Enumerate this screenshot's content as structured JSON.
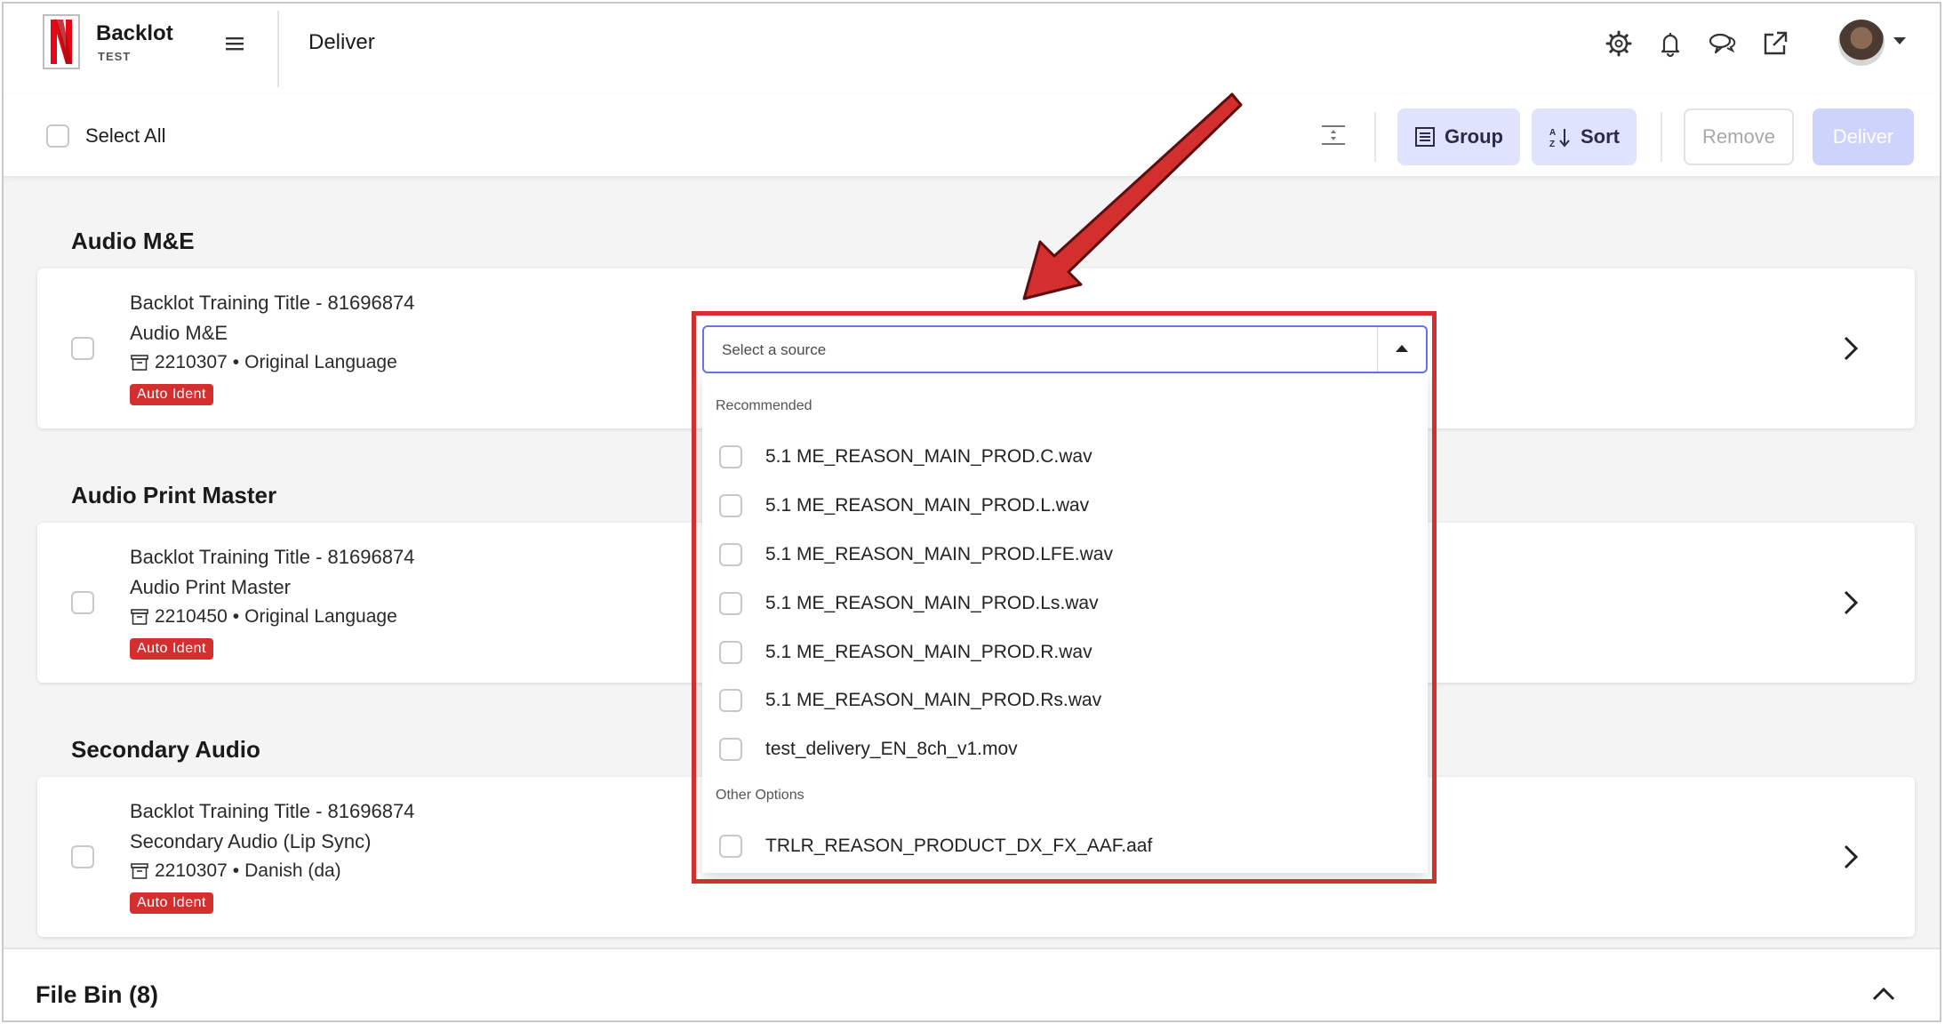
{
  "app": {
    "name": "Backlot",
    "env": "TEST",
    "page_title": "Deliver"
  },
  "header_icons": [
    "gear-icon",
    "bell-icon",
    "chat-icon",
    "external-link-icon"
  ],
  "toolbar": {
    "select_all_label": "Select All",
    "group_label": "Group",
    "sort_label": "Sort",
    "remove_label": "Remove",
    "deliver_label": "Deliver"
  },
  "sections": [
    {
      "title": "Audio M&E",
      "card": {
        "title": "Backlot Training Title - 81696874",
        "subtitle": "Audio M&E",
        "asset_id": "2210307",
        "language": "Original Language",
        "badge": "Auto Ident"
      }
    },
    {
      "title": "Audio Print Master",
      "card": {
        "title": "Backlot Training Title - 81696874",
        "subtitle": "Audio Print Master",
        "asset_id": "2210450",
        "language": "Original Language",
        "badge": "Auto Ident"
      }
    },
    {
      "title": "Secondary Audio",
      "card": {
        "title": "Backlot Training Title - 81696874",
        "subtitle": "Secondary Audio (Lip Sync)",
        "asset_id": "2210307",
        "language": "Danish (da)",
        "badge": "Auto Ident"
      }
    }
  ],
  "meta_separator": "•",
  "dropdown": {
    "placeholder": "Select a source",
    "recommended_label": "Recommended",
    "recommended": [
      "5.1 ME_REASON_MAIN_PROD.C.wav",
      "5.1 ME_REASON_MAIN_PROD.L.wav",
      "5.1 ME_REASON_MAIN_PROD.LFE.wav",
      "5.1 ME_REASON_MAIN_PROD.Ls.wav",
      "5.1 ME_REASON_MAIN_PROD.R.wav",
      "5.1 ME_REASON_MAIN_PROD.Rs.wav",
      "test_delivery_EN_8ch_v1.mov"
    ],
    "other_label": "Other Options",
    "other": [
      "TRLR_REASON_PRODUCT_DX_FX_AAF.aaf"
    ]
  },
  "file_bin": {
    "label": "File Bin (8)"
  },
  "colors": {
    "accent": "#6573e8",
    "button_bg": "#dfe3fb",
    "badge_red": "#d32f2f",
    "annotation_red": "#d32f2f"
  }
}
